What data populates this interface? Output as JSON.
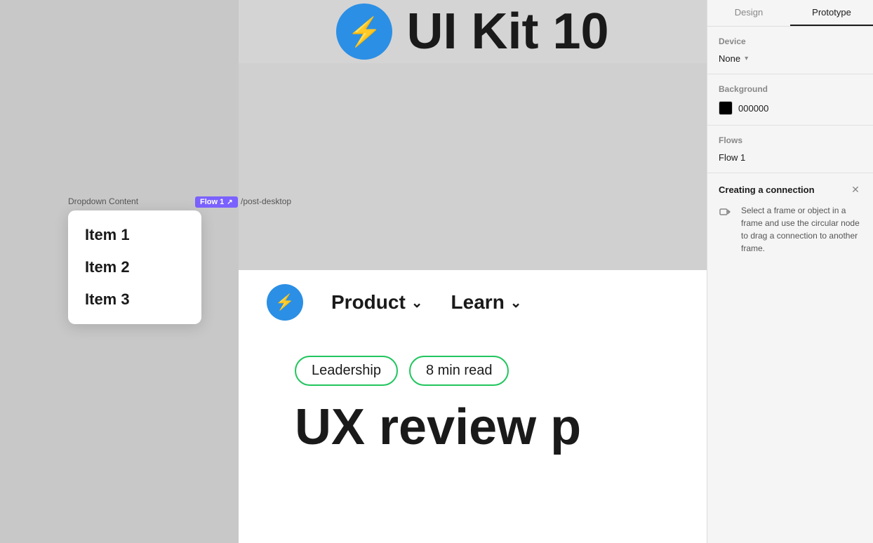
{
  "panel": {
    "tabs": [
      {
        "label": "Design",
        "active": false
      },
      {
        "label": "Prototype",
        "active": true
      }
    ],
    "device": {
      "section_title": "Device",
      "value": "None"
    },
    "background": {
      "section_title": "Background",
      "color_hex": "000000",
      "swatch_color": "#000000"
    },
    "flows": {
      "section_title": "Flows",
      "flow_name": "Flow 1"
    },
    "connection": {
      "title": "Creating a connection",
      "description": "Select a frame or object in a frame and use the circular node to drag a connection to another frame."
    }
  },
  "canvas": {
    "ui_kit_text": "UI Kit 10",
    "dropdown_label": "Dropdown Content",
    "post_label": "/post-desktop",
    "flow_badge": "Flow 1",
    "dropdown_items": [
      "Item 1",
      "Item 2",
      "Item 3"
    ],
    "nav_items": [
      {
        "label": "Product",
        "has_chevron": true
      },
      {
        "label": "Learn",
        "has_chevron": true
      }
    ],
    "tags": [
      "Leadership",
      "8 min read"
    ],
    "big_text": "UX review p"
  }
}
